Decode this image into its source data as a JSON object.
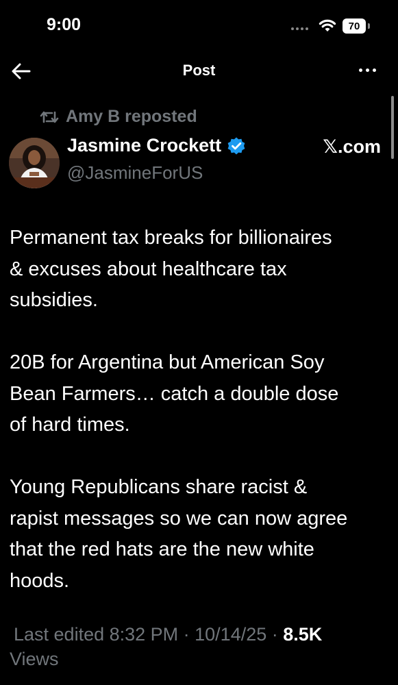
{
  "status_bar": {
    "time": "9:00",
    "battery": "70",
    "icons": [
      "signal-dots-icon",
      "wifi-icon",
      "battery-icon"
    ]
  },
  "nav": {
    "title": "Post",
    "back_icon": "arrow-left-icon",
    "more_icon": "more-horizontal-icon"
  },
  "post": {
    "repost_label": "Amy B reposted",
    "author_name": "Jasmine Crockett",
    "verified": true,
    "handle": "@JasmineForUS",
    "source": "𝕏.com",
    "paragraphs": [
      "Permanent tax breaks for billionaires\n& excuses about healthcare tax\nsubsidies.",
      "20B for Argentina but American Soy\nBean Farmers… catch a double dose\nof hard times.",
      "Young Republicans share racist &\nrapist messages so we can now agree\nthat the red hats are the new white\nhoods."
    ],
    "edited": "Last edited 8:32 PM · 10/14/25 ",
    "views_count": "8.5K",
    "views_label": "Views"
  },
  "colors": {
    "background": "#000000",
    "text": "#ffffff",
    "secondary": "#71767b",
    "verified": "#1d9bf0"
  }
}
